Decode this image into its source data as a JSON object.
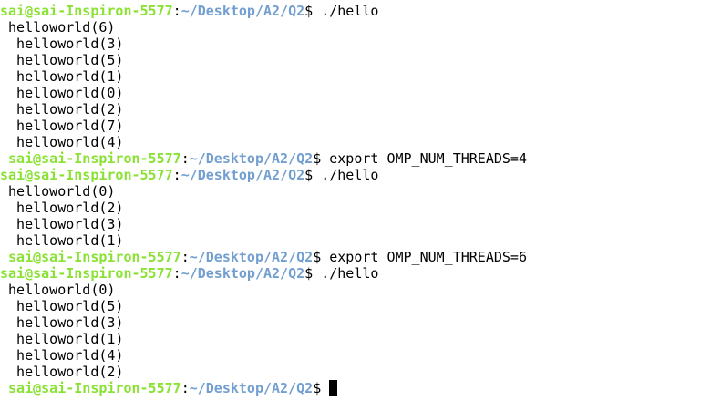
{
  "colors": {
    "prompt_user": "#8ae234",
    "prompt_path": "#729fcf",
    "text": "#000000",
    "background": "#ffffff"
  },
  "lines": [
    {
      "type": "prompt",
      "indent": "",
      "user": "sai@sai-Inspiron-5577",
      "path": "~/Desktop/A2/Q2",
      "symbol": "$",
      "command": " ./hello"
    },
    {
      "type": "output",
      "text": " helloworld(6)"
    },
    {
      "type": "output",
      "text": "  helloworld(3)"
    },
    {
      "type": "output",
      "text": "  helloworld(5)"
    },
    {
      "type": "output",
      "text": "  helloworld(1)"
    },
    {
      "type": "output",
      "text": "  helloworld(0)"
    },
    {
      "type": "output",
      "text": "  helloworld(2)"
    },
    {
      "type": "output",
      "text": "  helloworld(7)"
    },
    {
      "type": "output",
      "text": "  helloworld(4)"
    },
    {
      "type": "prompt",
      "indent": " ",
      "user": "sai@sai-Inspiron-5577",
      "path": "~/Desktop/A2/Q2",
      "symbol": "$",
      "command": " export OMP_NUM_THREADS=4"
    },
    {
      "type": "prompt",
      "indent": "",
      "user": "sai@sai-Inspiron-5577",
      "path": "~/Desktop/A2/Q2",
      "symbol": "$",
      "command": " ./hello"
    },
    {
      "type": "output",
      "text": " helloworld(0)"
    },
    {
      "type": "output",
      "text": "  helloworld(2)"
    },
    {
      "type": "output",
      "text": "  helloworld(3)"
    },
    {
      "type": "output",
      "text": "  helloworld(1)"
    },
    {
      "type": "prompt",
      "indent": " ",
      "user": "sai@sai-Inspiron-5577",
      "path": "~/Desktop/A2/Q2",
      "symbol": "$",
      "command": " export OMP_NUM_THREADS=6"
    },
    {
      "type": "prompt",
      "indent": "",
      "user": "sai@sai-Inspiron-5577",
      "path": "~/Desktop/A2/Q2",
      "symbol": "$",
      "command": " ./hello"
    },
    {
      "type": "output",
      "text": " helloworld(0)"
    },
    {
      "type": "output",
      "text": "  helloworld(5)"
    },
    {
      "type": "output",
      "text": "  helloworld(3)"
    },
    {
      "type": "output",
      "text": "  helloworld(1)"
    },
    {
      "type": "output",
      "text": "  helloworld(4)"
    },
    {
      "type": "output",
      "text": "  helloworld(2)"
    },
    {
      "type": "prompt",
      "indent": " ",
      "user": "sai@sai-Inspiron-5577",
      "path": "~/Desktop/A2/Q2",
      "symbol": "$",
      "command": " ",
      "cursor": true
    }
  ]
}
